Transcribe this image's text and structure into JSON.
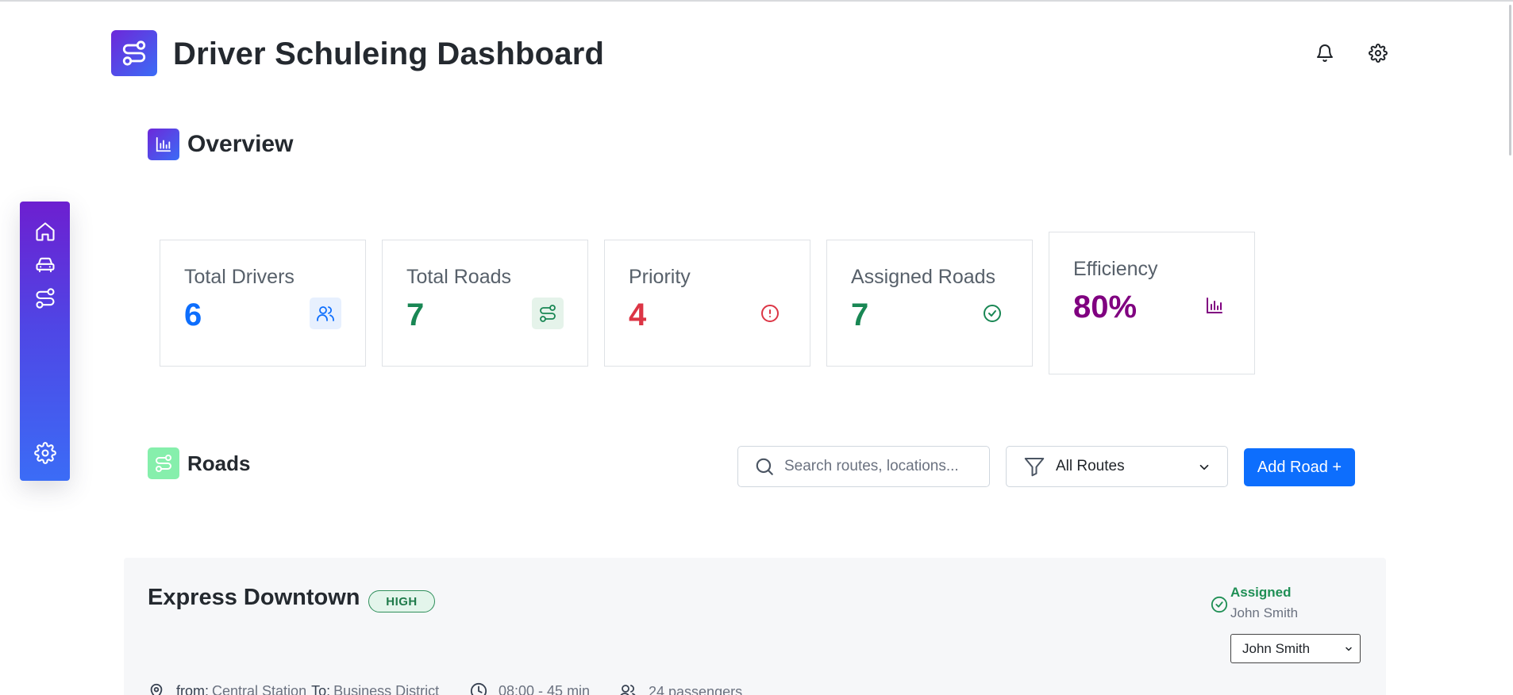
{
  "app": {
    "title": "Driver Schuleing Dashboard"
  },
  "colors": {
    "primary": "#0d6efd",
    "blue": "#0d6efd",
    "green": "#198754",
    "red": "#dc3545",
    "purple": "#800080",
    "gradient_start": "#6d28d9",
    "gradient_end": "#3b6cf6"
  },
  "header": {
    "icons": [
      "bell-icon",
      "gear-icon"
    ]
  },
  "sidebar": {
    "items": [
      {
        "icon": "home-icon"
      },
      {
        "icon": "car-icon"
      },
      {
        "icon": "route-icon"
      },
      {
        "icon": "gear-icon"
      }
    ]
  },
  "overview": {
    "title": "Overview",
    "stats": [
      {
        "label": "Total Drivers",
        "value": "6",
        "icon": "users-icon"
      },
      {
        "label": "Total Roads",
        "value": "7",
        "icon": "route-icon"
      },
      {
        "label": "Priority",
        "value": "4",
        "icon": "alert-circle-icon"
      },
      {
        "label": "Assigned Roads",
        "value": "7",
        "icon": "check-circle-icon"
      },
      {
        "label": "Efficiency",
        "value": "80%",
        "icon": "bar-chart-icon"
      }
    ]
  },
  "roads": {
    "title": "Roads",
    "search_placeholder": "Search routes, locations...",
    "filter_value": "All Routes",
    "add_label": "Add Road +",
    "items": [
      {
        "name": "Express Downtown",
        "priority": "HIGH",
        "status": "Assigned",
        "driver": "John Smith",
        "selected_driver": "John Smith",
        "from_label": "from:",
        "from": "Central Station",
        "to_label": "To:",
        "to": "Business District",
        "time": "08:00 - 45 min",
        "passengers": "24 passengers"
      }
    ]
  }
}
